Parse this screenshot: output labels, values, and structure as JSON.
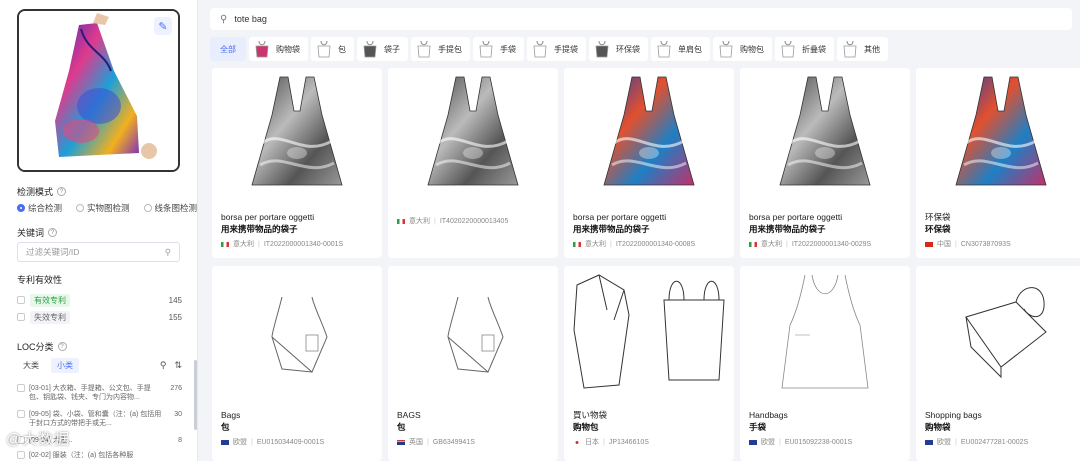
{
  "search": {
    "query": "tote bag"
  },
  "preview": {
    "edit_icon": "magic-wand-icon"
  },
  "detect_mode": {
    "title": "检测模式",
    "options": [
      "综合检测",
      "实物图检测",
      "线条图检测"
    ],
    "selected": "综合检测"
  },
  "keyword": {
    "title": "关键词",
    "placeholder": "过滤关键词/ID"
  },
  "validity": {
    "title": "专利有效性",
    "items": [
      {
        "label": "有效专利",
        "count": "145"
      },
      {
        "label": "失效专利",
        "count": "155"
      }
    ]
  },
  "loc": {
    "title": "LOC分类",
    "tabs": [
      "大类",
      "小类"
    ],
    "selected_tab": "小类",
    "items": [
      {
        "text": "[03-01] 大衣箱、手提箱、公文包、手提包、钥匙袋、钱夹、专门为内容物...",
        "count": "276"
      },
      {
        "text": "[09-05] 袋、小袋、管和囊（注：(a) 包括用于封口方式的带把手或无...",
        "count": "30"
      },
      {
        "text": "[09-04] 大篮...",
        "count": "8"
      },
      {
        "text": "[02-02] 服装（注：(a) 包括各种服",
        "count": ""
      }
    ]
  },
  "categories": [
    {
      "label": "全部",
      "active": true
    },
    {
      "label": "购物袋"
    },
    {
      "label": "包"
    },
    {
      "label": "袋子"
    },
    {
      "label": "手提包"
    },
    {
      "label": "手袋"
    },
    {
      "label": "手提袋"
    },
    {
      "label": "环保袋"
    },
    {
      "label": "单肩包"
    },
    {
      "label": "购物包"
    },
    {
      "label": "折叠袋"
    },
    {
      "label": "其他"
    }
  ],
  "results": [
    {
      "title": "borsa per portare oggetti",
      "sub": "用来携带物品的袋子",
      "country": "意大利",
      "id": "IT2022000001340-0001S",
      "flag": "it",
      "style": "gray"
    },
    {
      "title": "",
      "sub": "",
      "country": "意大利",
      "id": "IT4020220000013405",
      "flag": "it",
      "style": "gray"
    },
    {
      "title": "borsa per portare oggetti",
      "sub": "用来携带物品的袋子",
      "country": "意大利",
      "id": "IT2022000001340-0008S",
      "flag": "it",
      "style": "color"
    },
    {
      "title": "borsa per portare oggetti",
      "sub": "用来携带物品的袋子",
      "country": "意大利",
      "id": "IT2022000001340-0029S",
      "flag": "it",
      "style": "gray2"
    },
    {
      "title": "环保袋",
      "sub": "环保袋",
      "country": "中国",
      "id": "CN307387093S",
      "flag": "cn",
      "style": "color"
    },
    {
      "title": "Bags",
      "sub": "包",
      "country": "欧盟",
      "id": "EU015034409-0001S",
      "flag": "eu",
      "style": "line"
    },
    {
      "title": "BAGS",
      "sub": "包",
      "country": "英国",
      "id": "GB6349941S",
      "flag": "gb",
      "style": "line"
    },
    {
      "title": "買い物袋",
      "sub": "购物包",
      "country": "日本",
      "id": "JP1346610S",
      "flag": "jp",
      "style": "line2"
    },
    {
      "title": "Handbags",
      "sub": "手袋",
      "country": "欧盟",
      "id": "EU015092238-0001S",
      "flag": "eu",
      "style": "line3"
    },
    {
      "title": "Shopping bags",
      "sub": "购物袋",
      "country": "欧盟",
      "id": "EU002477281-0002S",
      "flag": "eu",
      "style": "line4"
    }
  ],
  "watermark": "@大数据"
}
